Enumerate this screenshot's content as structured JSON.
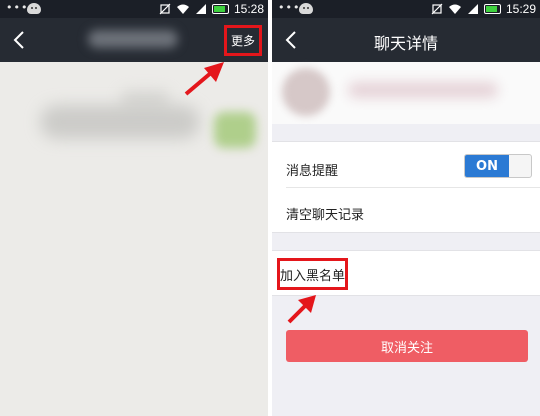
{
  "left_screen": {
    "status": {
      "dots": "•••",
      "time": "15:28"
    },
    "navbar": {
      "more_label": "更多"
    }
  },
  "right_screen": {
    "status": {
      "dots": "•••",
      "time": "15:29"
    },
    "navbar": {
      "title": "聊天详情"
    },
    "settings": {
      "message_alert_label": "消息提醒",
      "message_alert_toggle": "ON",
      "clear_history_label": "清空聊天记录"
    },
    "blacklist_label": "加入黑名单",
    "unfollow_label": "取消关注"
  },
  "colors": {
    "highlight_border": "#e4161b",
    "navbar_bg": "#262b33",
    "toggle_on": "#2b7ad4",
    "unfollow_button": "#ef5d64"
  },
  "icons": [
    "back-arrow-icon",
    "notification-muted-icon",
    "wifi-icon",
    "signal-icon",
    "battery-icon",
    "android-notification-icon"
  ]
}
